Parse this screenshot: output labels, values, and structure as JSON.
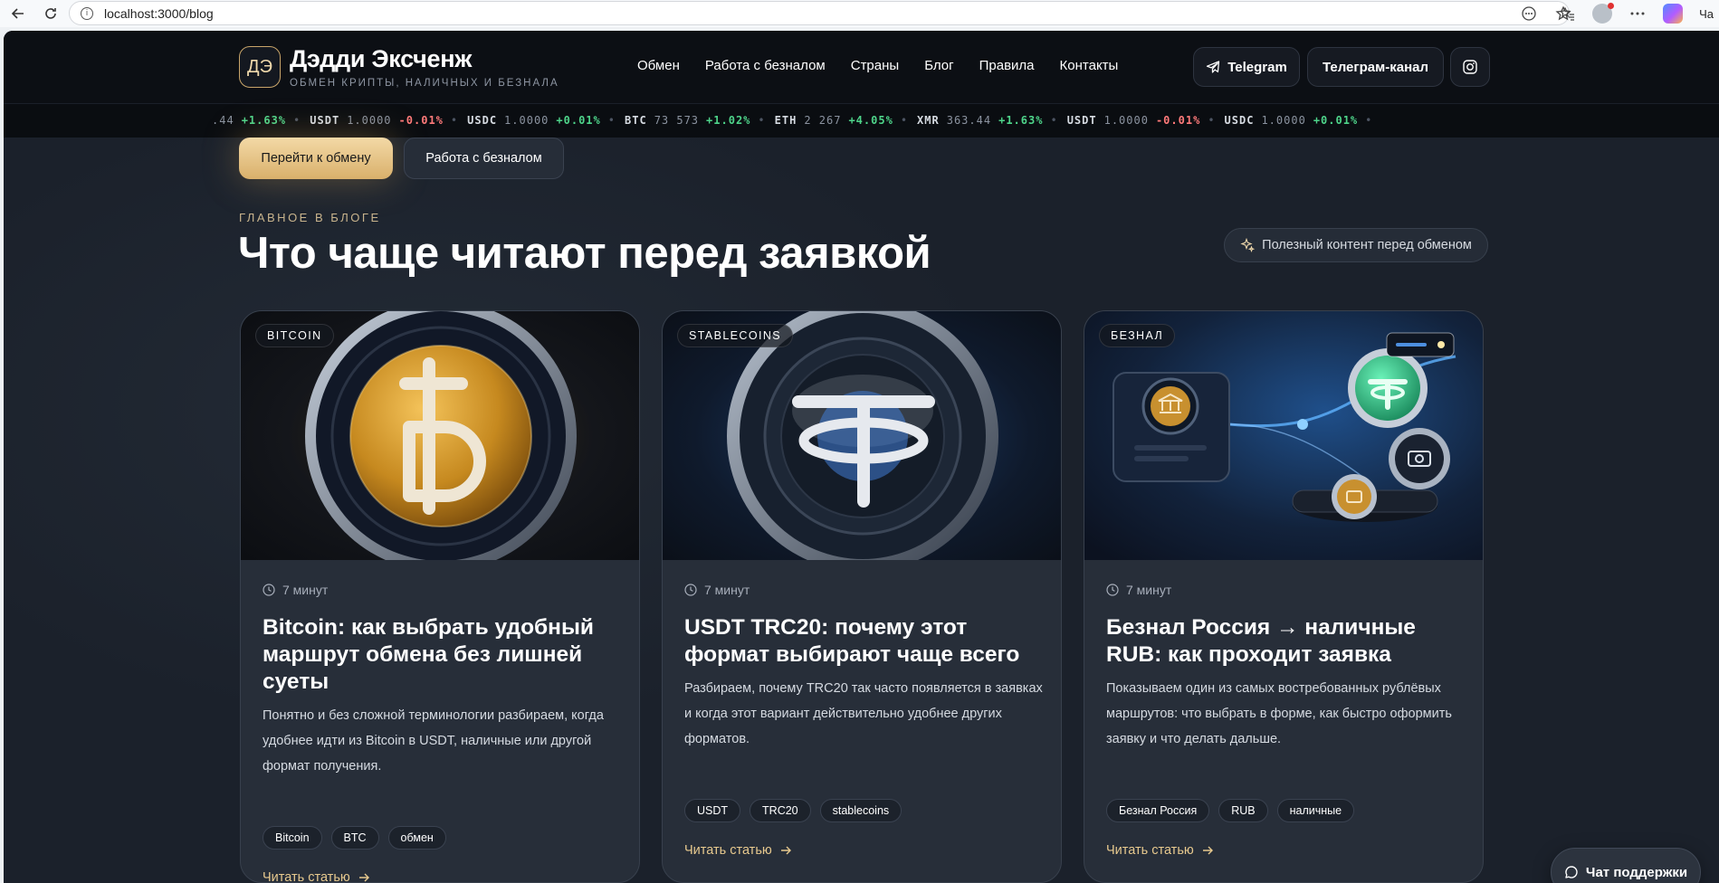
{
  "browser": {
    "url": "localhost:3000/blog",
    "cut_tab_text": "Ча"
  },
  "header": {
    "logo_mark": "ДЭ",
    "brand": "Дэдди Эксченж",
    "tagline": "ОБМЕН КРИПТЫ, НАЛИЧНЫХ И БЕЗНАЛА",
    "nav": [
      "Обмен",
      "Работа с безналом",
      "Страны",
      "Блог",
      "Правила",
      "Контакты"
    ],
    "telegram_label": "Telegram",
    "channel_label": "Телеграм-канал"
  },
  "ticker": [
    {
      "sym": "",
      "price": ".44",
      "change": "+1.63%",
      "dir": "up"
    },
    {
      "sym": "USDT",
      "price": "1.0000",
      "change": "-0.01%",
      "dir": "dn"
    },
    {
      "sym": "USDC",
      "price": "1.0000",
      "change": "+0.01%",
      "dir": "up"
    },
    {
      "sym": "BTC",
      "price": "73 573",
      "change": "+1.02%",
      "dir": "up"
    },
    {
      "sym": "ETH",
      "price": "2 267",
      "change": "+4.05%",
      "dir": "up"
    },
    {
      "sym": "XMR",
      "price": "363.44",
      "change": "+1.63%",
      "dir": "up"
    },
    {
      "sym": "USDT",
      "price": "1.0000",
      "change": "-0.01%",
      "dir": "dn"
    },
    {
      "sym": "USDC",
      "price": "1.0000",
      "change": "+0.01%",
      "dir": "up"
    }
  ],
  "hero": {
    "primary_cta": "Перейти к обмену",
    "secondary_cta": "Работа с безналом"
  },
  "section": {
    "eyebrow": "ГЛАВНОЕ В БЛОГЕ",
    "title": "Что чаще читают перед заявкой",
    "hint": "Полезный контент перед обменом"
  },
  "cards": [
    {
      "tag": "BITCOIN",
      "read_time": "7 минут",
      "title": "Bitcoin: как выбрать удобный маршрут обмена без лишней суеты",
      "desc": "Понятно и без сложной терминологии разбираем, когда удобнее идти из Bitcoin в USDT, наличные или другой формат получения.",
      "chips": [
        "Bitcoin",
        "BTC",
        "обмен"
      ],
      "link": "Читать статью"
    },
    {
      "tag": "STABLECOINS",
      "read_time": "7 минут",
      "title": "USDT TRC20: почему этот формат выбирают чаще всего",
      "desc": "Разбираем, почему TRC20 так часто появляется в заявках и когда этот вариант действительно удобнее других форматов.",
      "chips": [
        "USDT",
        "TRC20",
        "stablecoins"
      ],
      "link": "Читать статью"
    },
    {
      "tag": "БЕЗНАЛ",
      "read_time": "7 минут",
      "title": "Безнал Россия → наличные RUB: как проходит заявка",
      "desc": "Показываем один из самых востребованных рублёвых маршрутов: что выбрать в форме, как быстро оформить заявку и что делать дальше.",
      "chips": [
        "Безнал Россия",
        "RUB",
        "наличные"
      ],
      "link": "Читать статью"
    }
  ],
  "support": {
    "label": "Чат поддержки"
  },
  "colors": {
    "accent_gold": "#e7c98e",
    "ticker_up": "#4ed48a",
    "ticker_down": "#ff7a7a",
    "page_bg": "#1b212b"
  }
}
